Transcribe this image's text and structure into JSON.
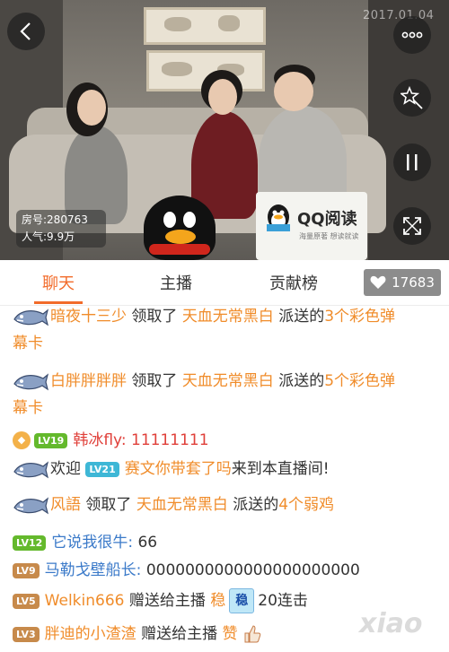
{
  "video": {
    "date": "2017.01.04",
    "room_label": "房号:280763",
    "popularity_label": "人气:9.9万",
    "sponsor": {
      "brand": "QQ阅读",
      "slogan": "海量原著 想读就读"
    }
  },
  "tabs": [
    {
      "label": "聊天",
      "active": true
    },
    {
      "label": "主播",
      "active": false
    },
    {
      "label": "贡献榜",
      "active": false
    }
  ],
  "likes": {
    "count": "17683",
    "icon": "heart-icon"
  },
  "chat": [
    {
      "type": "system",
      "user": "暗夜十三少",
      "action": "领取了",
      "giver": "天血无常黑白",
      "suffix": "派送的",
      "item": "3个彩色弹",
      "item_cont": "幕卡"
    },
    {
      "type": "system",
      "user": "白胖胖胖胖",
      "action": "领取了",
      "giver": "天血无常黑白",
      "suffix": "派送的",
      "item": "5个彩色弹",
      "item_cont": "幕卡"
    },
    {
      "type": "chat",
      "level": "LV19",
      "user": "韩冰fly:",
      "text": "11111111"
    },
    {
      "type": "welcome",
      "prefix": "欢迎",
      "level": "LV21",
      "user": "赛文你带套了吗",
      "suffix": "来到本直播间!"
    },
    {
      "type": "system",
      "user": "风語",
      "action": "领取了",
      "giver": "天血无常黑白",
      "suffix": "派送的",
      "item": "4个弱鸡"
    },
    {
      "type": "chat",
      "level": "LV12",
      "user": "它说我很牛:",
      "text": "66"
    },
    {
      "type": "chat",
      "level": "LV9",
      "user": "马勒戈壁船长:",
      "text": "0000000000000000000000"
    },
    {
      "type": "gift",
      "level": "LV5",
      "user": "Welkin666",
      "action": "赠送给主播",
      "gift": "稳",
      "combo": "20连击"
    },
    {
      "type": "gift",
      "level": "LV3",
      "user": "胖迪的小渣渣",
      "action": "赠送给主播",
      "gift": "赞"
    }
  ],
  "watermark": "xiao"
}
